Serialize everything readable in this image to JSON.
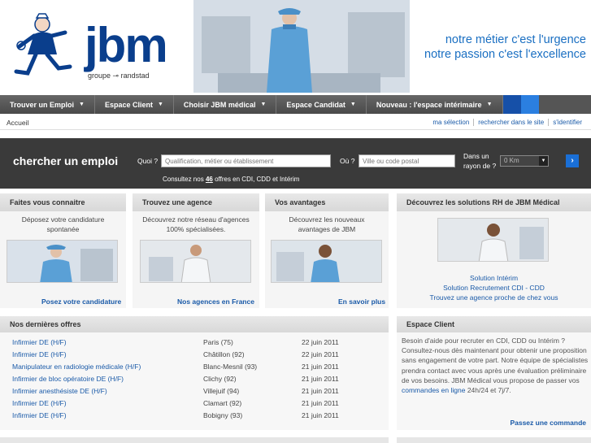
{
  "header": {
    "logo_text": "jbm",
    "logo_sub": "groupe ⊸ randstad",
    "slogan_line1": "notre métier c'est l'urgence",
    "slogan_line2": "notre passion c'est l'excellence"
  },
  "nav": {
    "items": [
      {
        "label": "Trouver un Emploi"
      },
      {
        "label": "Espace Client"
      },
      {
        "label": "Choisir JBM médical"
      },
      {
        "label": "Espace Candidat"
      },
      {
        "label": "Nouveau : l'espace intérimaire"
      }
    ]
  },
  "breadcrumb": "Accueil",
  "toplinks": [
    "ma sélection",
    "rechercher dans le site",
    "s'identifier"
  ],
  "search": {
    "title": "chercher un emploi",
    "quoi_label": "Quoi ?",
    "quoi_placeholder": "Qualification, métier ou établissement",
    "ou_label": "Où ?",
    "ou_placeholder": "Ville ou code postal",
    "rayon_label_1": "Dans un",
    "rayon_label_2": "rayon de ?",
    "rayon_value": "0 Km",
    "go_label": "›",
    "consult_prefix": "Consultez nos",
    "consult_count": "46",
    "consult_suffix": "offres en CDI, CDD et Intérim"
  },
  "boxes": [
    {
      "title": "Faites vous connaitre",
      "desc": "Déposez votre candidature spontanée",
      "link": "Posez votre candidature"
    },
    {
      "title": "Trouvez une agence",
      "desc": "Découvrez notre réseau d'agences 100% spécialisées.",
      "link": "Nos agences en France"
    },
    {
      "title": "Vos avantages",
      "desc": "Découvrez les nouveaux avantages de JBM",
      "link": "En savoir plus"
    },
    {
      "title": "Découvrez les solutions RH de JBM Médical",
      "links": [
        "Solution Intérim",
        "Solution Recrutement CDI - CDD",
        "Trouvez une agence proche de chez vous"
      ]
    }
  ],
  "offers": {
    "title": "Nos dernières offres",
    "rows": [
      {
        "title": "Infirmier DE (H/F)",
        "city": "Paris (75)",
        "date": "22 juin 2011"
      },
      {
        "title": "Infirmier DE (H/F)",
        "city": "Châtillon (92)",
        "date": "22 juin 2011"
      },
      {
        "title": "Manipulateur en radiologie médicale (H/F)",
        "city": "Blanc-Mesnil (93)",
        "date": "21 juin 2011"
      },
      {
        "title": "Infirmier de bloc opératoire DE (H/F)",
        "city": "Clichy (92)",
        "date": "21 juin 2011"
      },
      {
        "title": "Infirmier anesthésiste DE (H/F)",
        "city": "Villejuif (94)",
        "date": "21 juin 2011"
      },
      {
        "title": "Infirmier DE (H/F)",
        "city": "Clamart (92)",
        "date": "21 juin 2011"
      },
      {
        "title": "Infirmier DE (H/F)",
        "city": "Bobigny (93)",
        "date": "21 juin 2011"
      }
    ]
  },
  "client": {
    "title": "Espace Client",
    "text_1": "Besoin d'aide pour recruter en CDI, CDD ou Intérim ? Consultez-nous dès maintenant pour obtenir une proposition sans engagement de votre part. Notre équipe de spécialistes prendra contact avec vous après une évaluation préliminaire de vos besoins. JBM Médical vous propose de passer vos",
    "text_link": "commandes en ligne",
    "text_2": "24h/24 et 7j/7.",
    "cta": "Passez une commande"
  },
  "colors": {
    "brand": "#0a3e8c",
    "link": "#1a5aa8",
    "slogan": "#1a6fc2",
    "nav": "#555555",
    "search_band": "#3a3a3a",
    "accent": "#1a6fd6"
  }
}
